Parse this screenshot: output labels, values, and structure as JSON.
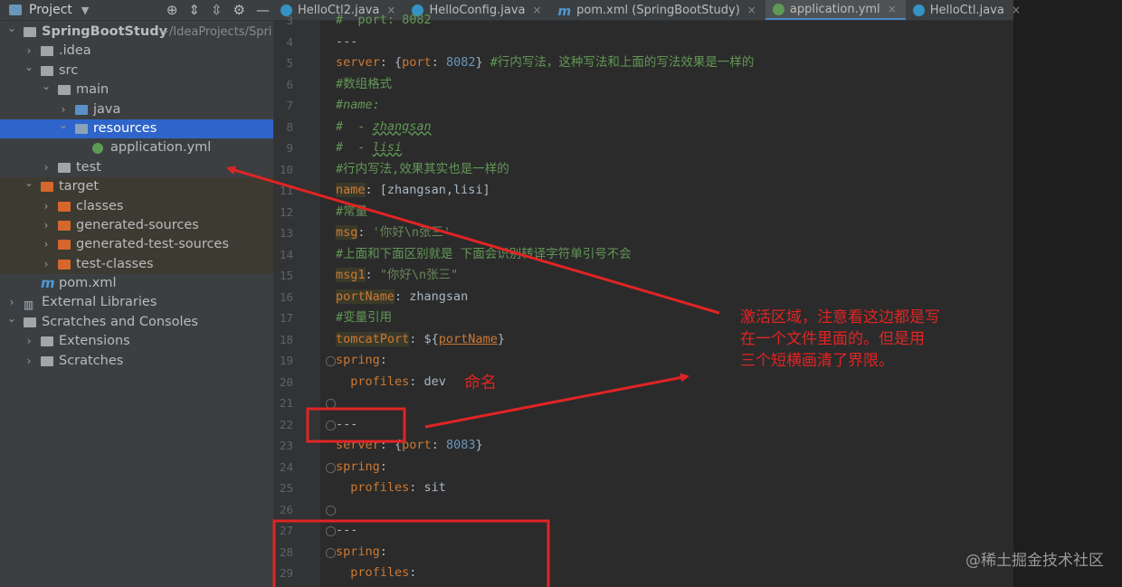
{
  "project_panel": {
    "title": "Project",
    "tree": [
      {
        "label": "SpringBootStudy",
        "suffix": "~/IdeaProjects/Spri",
        "depth": 0,
        "expanded": true,
        "icon": "folder-icon"
      },
      {
        "label": ".idea",
        "depth": 1,
        "expanded": false,
        "icon": "folder-icon"
      },
      {
        "label": "src",
        "depth": 1,
        "expanded": true,
        "icon": "folder-icon"
      },
      {
        "label": "main",
        "depth": 2,
        "expanded": true,
        "icon": "folder-icon"
      },
      {
        "label": "java",
        "depth": 3,
        "expanded": false,
        "icon": "source-folder-icon"
      },
      {
        "label": "resources",
        "depth": 3,
        "expanded": true,
        "icon": "resources-folder-icon",
        "selected": true
      },
      {
        "label": "application.yml",
        "depth": 4,
        "icon": "yaml-file-icon"
      },
      {
        "label": "test",
        "depth": 2,
        "expanded": false,
        "icon": "folder-icon"
      },
      {
        "label": "target",
        "depth": 1,
        "expanded": true,
        "icon": "excluded-folder-icon"
      },
      {
        "label": "classes",
        "depth": 2,
        "expanded": false,
        "icon": "excluded-folder-icon"
      },
      {
        "label": "generated-sources",
        "depth": 2,
        "expanded": false,
        "icon": "excluded-folder-icon"
      },
      {
        "label": "generated-test-sources",
        "depth": 2,
        "expanded": false,
        "icon": "excluded-folder-icon"
      },
      {
        "label": "test-classes",
        "depth": 2,
        "expanded": false,
        "icon": "excluded-folder-icon"
      },
      {
        "label": "pom.xml",
        "depth": 1,
        "icon": "maven-icon"
      },
      {
        "label": "External Libraries",
        "depth": 0,
        "expanded": false,
        "icon": "library-icon"
      },
      {
        "label": "Scratches and Consoles",
        "depth": 0,
        "expanded": true,
        "icon": "scratches-icon"
      },
      {
        "label": "Extensions",
        "depth": 1,
        "expanded": false,
        "icon": "folder-icon"
      },
      {
        "label": "Scratches",
        "depth": 1,
        "expanded": false,
        "icon": "folder-icon"
      }
    ]
  },
  "tabs": [
    {
      "label": "HelloCtl2.java",
      "icon": "java-class-icon"
    },
    {
      "label": "HelloConfig.java",
      "icon": "java-class-icon"
    },
    {
      "label": "pom.xml (SpringBootStudy)",
      "icon": "maven-icon"
    },
    {
      "label": "application.yml",
      "icon": "yaml-file-icon",
      "active": true
    },
    {
      "label": "HelloCtl.java",
      "icon": "java-class-icon"
    }
  ],
  "editor": {
    "lines": [
      {
        "num": "3",
        "html": "<span class='c'>#  port: 8082</span>"
      },
      {
        "num": "4",
        "html": "<span class='v'>---</span>"
      },
      {
        "num": "5",
        "html": "<span class='k'>server</span><span class='v'>: {</span><span class='k'>port</span><span class='v'>: </span><span class='n'>8082</span><span class='v'>} </span><span class='c'>#行内写法，这种写法和上面的写法效果是一样的</span>"
      },
      {
        "num": "6",
        "html": "<span class='c'>#数组格式</span>"
      },
      {
        "num": "7",
        "html": "<span class='ci'>#name:</span>"
      },
      {
        "num": "8",
        "html": "<span class='ci'>#  - </span><span class='cu'>zhangsan</span>"
      },
      {
        "num": "9",
        "html": "<span class='ci'>#  - </span><span class='cu'>lisi</span>"
      },
      {
        "num": "10",
        "html": "<span class='c'>#行内写法,效果其实也是一样的</span>"
      },
      {
        "num": "11",
        "html": "<span class='k hl'>name</span><span class='v'>: [zhangsan,lisi]</span>"
      },
      {
        "num": "12",
        "html": "<span class='c'>#常量</span>"
      },
      {
        "num": "13",
        "html": "<span class='k hl'>msg</span><span class='v'>: </span><span class='s'>'你好\\n张三'</span>"
      },
      {
        "num": "14",
        "html": "<span class='c'>#上面和下面区别就是 下面会识别转译字符单引号不会</span>"
      },
      {
        "num": "15",
        "html": "<span class='k hl'>msg1</span><span class='v'>: </span><span class='s'>\"你好\\n张三\"</span>"
      },
      {
        "num": "16",
        "html": "<span class='k hl'>portName</span><span class='v'>: zhangsan</span>"
      },
      {
        "num": "17",
        "html": "<span class='c'>#变量引用</span>"
      },
      {
        "num": "18",
        "html": "<span class='k hl'>tomcatPort</span><span class='v'>: ${</span><span class='k' style='text-decoration:underline'>portName</span><span class='v'>}</span>"
      },
      {
        "num": "19",
        "html": "<span class='k'>spring</span><span class='v'>:</span>",
        "fold": true
      },
      {
        "num": "20",
        "html": "<span class='k'>  profiles</span><span class='v'>: dev</span>"
      },
      {
        "num": "21",
        "html": "",
        "fold": true
      },
      {
        "num": "22",
        "html": "<span class='v'>---</span>",
        "fold": true
      },
      {
        "num": "23",
        "html": "<span class='k'>server</span><span class='v'>: {</span><span class='k'>port</span><span class='v'>: </span><span class='n'>8083</span><span class='v'>}</span>"
      },
      {
        "num": "24",
        "html": "<span class='k'>spring</span><span class='v'>:</span>",
        "fold": true
      },
      {
        "num": "25",
        "html": "<span class='k'>  profiles</span><span class='v'>: sit</span>"
      },
      {
        "num": "26",
        "html": "",
        "fold": true
      },
      {
        "num": "27",
        "html": "<span class='v'>---</span>",
        "fold": true
      },
      {
        "num": "28",
        "html": "<span class='k'>spring</span><span class='v'>:</span>",
        "fold": true
      },
      {
        "num": "29",
        "html": "<span class='k'>  profiles</span><span class='v'>:</span>"
      }
    ]
  },
  "annotations": {
    "naming": "命名",
    "explain_line1": "激活区域，注意看这边都是写",
    "explain_line2": "在一个文件里面的。但是用",
    "explain_line3": "三个短横画清了界限。"
  },
  "watermark": "@稀土掘金技术社区",
  "colors": {
    "annotation": "#e02424",
    "selection": "#2f65ca"
  }
}
